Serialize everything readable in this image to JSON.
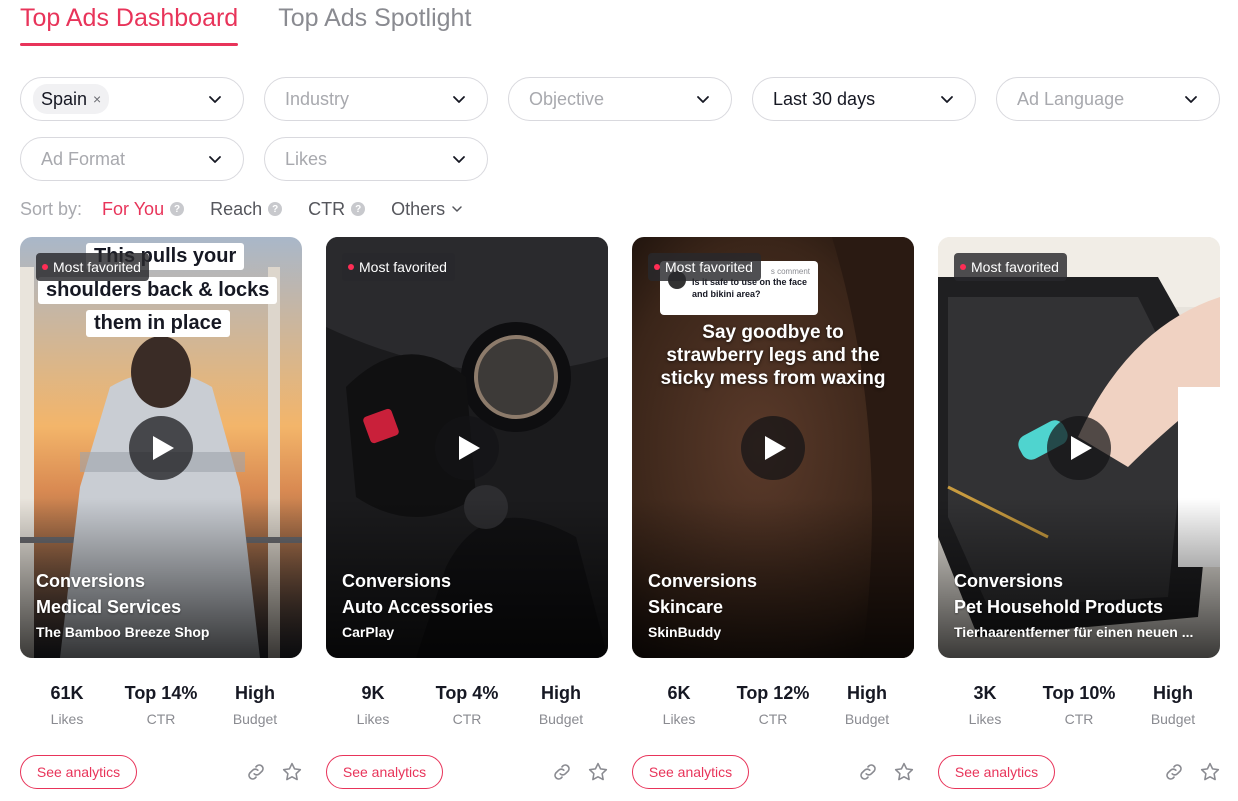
{
  "tabs": [
    {
      "label": "Top Ads Dashboard",
      "active": true
    },
    {
      "label": "Top Ads Spotlight",
      "active": false
    }
  ],
  "filters": {
    "country": {
      "chip": "Spain",
      "chip_remove": "×"
    },
    "industry": {
      "placeholder": "Industry"
    },
    "objective": {
      "placeholder": "Objective"
    },
    "period": {
      "value": "Last 30 days"
    },
    "ad_language": {
      "placeholder": "Ad Language"
    },
    "ad_format": {
      "placeholder": "Ad Format"
    },
    "likes": {
      "placeholder": "Likes"
    }
  },
  "sort": {
    "label": "Sort by:",
    "options": [
      {
        "label": "For You",
        "active": true,
        "help": "?"
      },
      {
        "label": "Reach",
        "active": false,
        "help": "?"
      },
      {
        "label": "CTR",
        "active": false,
        "help": "?"
      },
      {
        "label": "Others",
        "active": false
      }
    ]
  },
  "cards": [
    {
      "badge": "Most favorited",
      "overlay": [
        "This pulls your",
        "shoulders back & locks",
        "them in place"
      ],
      "objective": "Conversions",
      "industry": "Medical Services",
      "advertiser": "The Bamboo Breeze Shop",
      "stats": [
        {
          "value": "61K",
          "label": "Likes"
        },
        {
          "value": "Top 14%",
          "label": "CTR"
        },
        {
          "value": "High",
          "label": "Budget"
        }
      ],
      "action": "See analytics"
    },
    {
      "badge": "Most favorited",
      "objective": "Conversions",
      "industry": "Auto Accessories",
      "advertiser": "CarPlay",
      "stats": [
        {
          "value": "9K",
          "label": "Likes"
        },
        {
          "value": "Top 4%",
          "label": "CTR"
        },
        {
          "value": "High",
          "label": "Budget"
        }
      ],
      "action": "See analytics"
    },
    {
      "badge": "Most favorited",
      "comment": {
        "title": "s comment",
        "body": "Is it safe to use on the face and bikini area?"
      },
      "overlay": [
        "Say goodbye to",
        "strawberry legs and the",
        "sticky mess from waxing"
      ],
      "objective": "Conversions",
      "industry": "Skincare",
      "advertiser": "SkinBuddy",
      "stats": [
        {
          "value": "6K",
          "label": "Likes"
        },
        {
          "value": "Top 12%",
          "label": "CTR"
        },
        {
          "value": "High",
          "label": "Budget"
        }
      ],
      "action": "See analytics"
    },
    {
      "badge": "Most favorited",
      "objective": "Conversions",
      "industry": "Pet Household Products",
      "advertiser": "Tierhaarentferner für einen neuen ...",
      "stats": [
        {
          "value": "3K",
          "label": "Likes"
        },
        {
          "value": "Top 10%",
          "label": "CTR"
        },
        {
          "value": "High",
          "label": "Budget"
        }
      ],
      "action": "See analytics"
    }
  ],
  "colors": {
    "accent": "#e8345a",
    "badge_dot": "#ff2d55"
  }
}
